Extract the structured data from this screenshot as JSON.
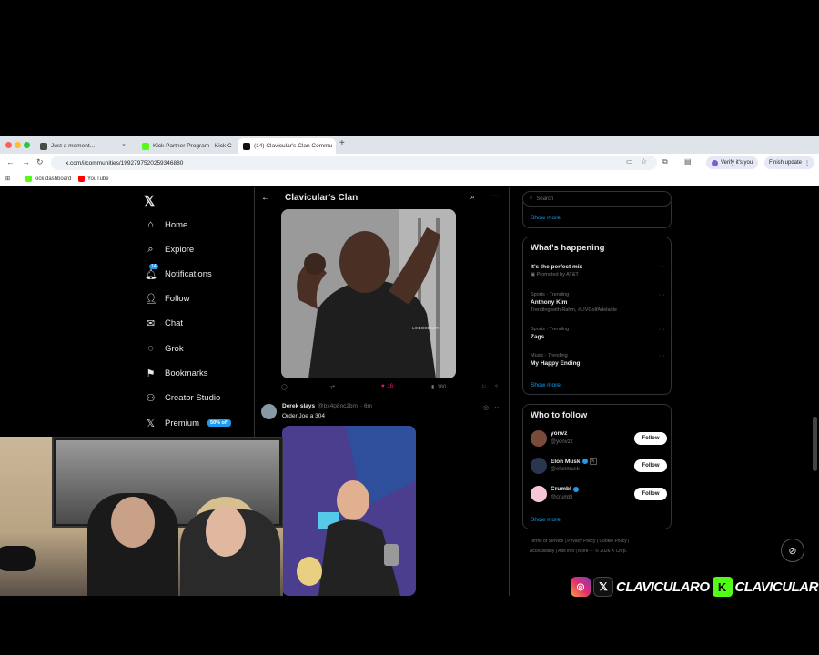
{
  "browser": {
    "tabs": [
      {
        "label": "Just a moment...",
        "fav_color": "#4a4a4a"
      },
      {
        "label": "Kick Partner Program - Kick C",
        "fav_color": "#53fc18"
      },
      {
        "label": "(14) Clavicular's Clan Commu",
        "fav_color": "#111111"
      }
    ],
    "new_tab": "+",
    "url": "x.com/i/communities/1992797520259346880",
    "verify_label": "Verify it's you",
    "finish_label": "Finish update",
    "bookmarks": [
      {
        "label": "kick dashboard",
        "color": "#53fc18"
      },
      {
        "label": "YouTube",
        "color": "#ff0000"
      }
    ]
  },
  "nav": {
    "logo": "𝕏",
    "items": [
      {
        "label": "Home",
        "icon": "⌂"
      },
      {
        "label": "Explore",
        "icon": "⌕"
      },
      {
        "label": "Notifications",
        "icon": "🔔︎",
        "badge": "14"
      },
      {
        "label": "Follow",
        "icon": "👤︎"
      },
      {
        "label": "Chat",
        "icon": "✉"
      },
      {
        "label": "Grok",
        "icon": "◌"
      },
      {
        "label": "Bookmarks",
        "icon": "⚑"
      },
      {
        "label": "Creator Studio",
        "icon": "⚇"
      },
      {
        "label": "Premium",
        "icon": "𝕏",
        "badge": "50% off"
      }
    ]
  },
  "column": {
    "title": "Clavicular's Clan",
    "back": "←",
    "search": "⌕",
    "more": "···"
  },
  "post1": {
    "watermark": "LIKEGOD5ETH",
    "actions": {
      "reply": "",
      "repost": "",
      "likes": "16",
      "views": "180"
    }
  },
  "post2": {
    "name": "Derek slays",
    "handle": "@bx4p8nc2bm",
    "time": "· 6m",
    "text": "Order Joe a 304"
  },
  "sidebar": {
    "search_placeholder": "Search",
    "show_more_top": "Show more",
    "whats_happening": {
      "title": "What's happening",
      "trends": [
        {
          "category": "",
          "name": "It's the perfect mix",
          "sub": "Promoted by AT&T"
        },
        {
          "category": "Sports · Trending",
          "name": "Anthony Kim",
          "sub": "Trending with Rahm, #LIVGolfAdelaide"
        },
        {
          "category": "Sports · Trending",
          "name": "Zags",
          "sub": ""
        },
        {
          "category": "Music · Trending",
          "name": "My Happy Ending",
          "sub": ""
        }
      ],
      "show_more": "Show more"
    },
    "who_to_follow": {
      "title": "Who to follow",
      "users": [
        {
          "name": "yonvz",
          "handle": "@yonvzz",
          "color": "#7a4b3a"
        },
        {
          "name": "Elon Musk",
          "handle": "@elonmusk",
          "color": "#2a3550"
        },
        {
          "name": "Crumbl",
          "handle": "@crumbl",
          "color": "#f5c6d6"
        }
      ],
      "follow_label": "Follow",
      "show_more": "Show more"
    },
    "footer": {
      "line1": "Terms of Service  |  Privacy Policy  |  Cookie Policy  |",
      "line2": "Accessibility  |  Ads info  |  More ···  © 2026 X Corp."
    }
  },
  "overlay": {
    "ig": "◎",
    "x": "𝕏",
    "handle1": "CLAVICULARO",
    "k": "K",
    "handle2": "CLAVICULAR"
  },
  "fab_icon": "⊘"
}
